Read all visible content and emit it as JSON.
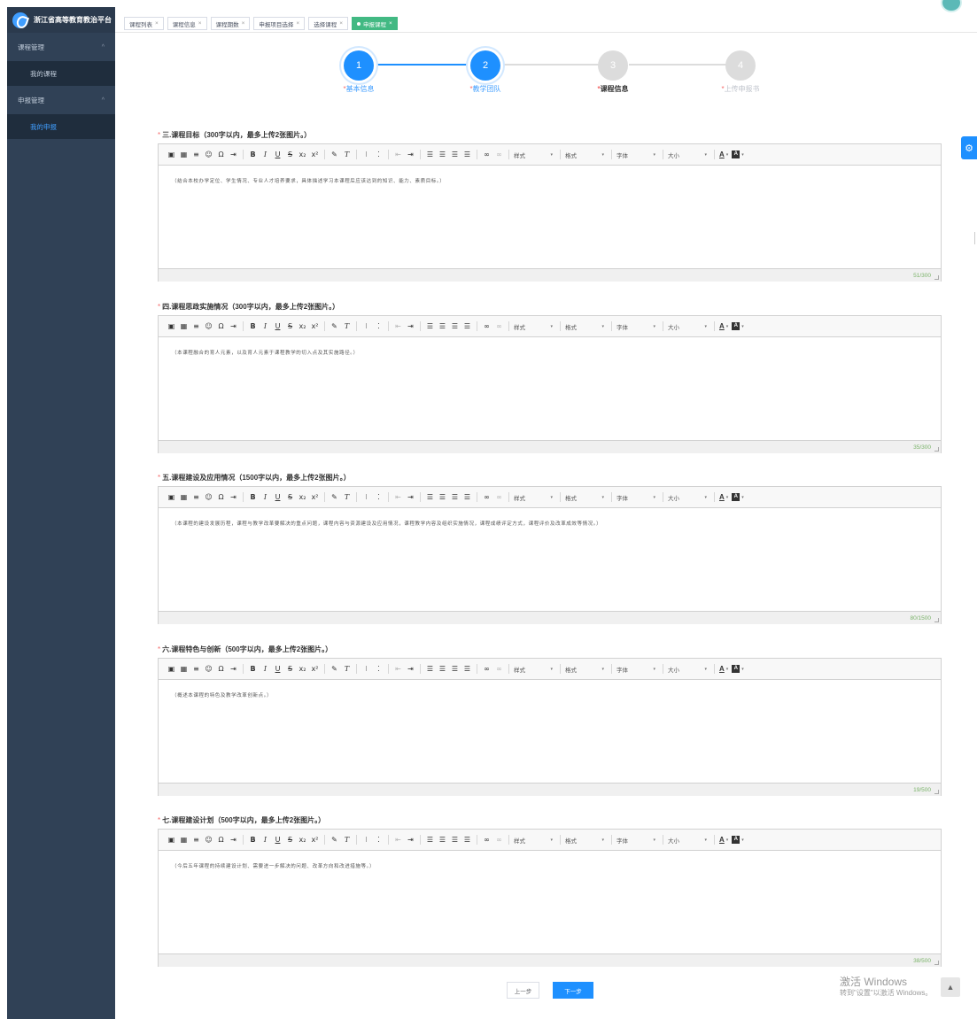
{
  "app": {
    "title": "浙江省高等教育教治平台"
  },
  "sidebar": {
    "groups": [
      {
        "label": "课程管理",
        "items": [
          "我的课程"
        ]
      },
      {
        "label": "申报管理",
        "items": [
          "我的申报"
        ]
      }
    ],
    "chevron": "^",
    "active_item": "我的申报"
  },
  "tabs": [
    {
      "label": "课程列表",
      "active": false
    },
    {
      "label": "课程信息",
      "active": false
    },
    {
      "label": "课程期数",
      "active": false
    },
    {
      "label": "申报项目选择",
      "active": false
    },
    {
      "label": "选择课程",
      "active": false
    },
    {
      "label": "申报课程",
      "active": true
    }
  ],
  "tab_close": "×",
  "steps": [
    {
      "num": "1",
      "label": "基本信息",
      "required": "*",
      "state": "done"
    },
    {
      "num": "2",
      "label": "教学团队",
      "required": "*",
      "state": "done"
    },
    {
      "num": "3",
      "label": "课程信息",
      "required": "*",
      "state": "current"
    },
    {
      "num": "4",
      "label": "上传申报书",
      "required": "*",
      "state": "todo"
    }
  ],
  "toolbar": {
    "combos": [
      "样式",
      "格式",
      "字体",
      "大小"
    ],
    "combo_arrow": "▾"
  },
  "sections": [
    {
      "required": "*",
      "title": "三.课程目标（300字以内，最多上传2张图片。）",
      "placeholder": "（结合本校办学定位、学生情况、专业人才培养要求，具体描述学习本课程后应该达到的知识、能力、素质目标。）",
      "count": "51/300"
    },
    {
      "required": "*",
      "title": "四.课程思政实施情况（300字以内，最多上传2张图片。）",
      "placeholder": "（本课程融合的育人元素，以及育人元素于课程教学的切入点及其实施路径。）",
      "count": "35/300"
    },
    {
      "required": "*",
      "title": "五.课程建设及应用情况（1500字以内，最多上传2张图片。）",
      "placeholder": "（本课程的建设发展历程，课程与教学改革要解决的重点问题，课程内容与资源建设及应用情况，课程教学内容及组织实施情况，课程成绩评定方式，课程评价及改革成效等情况。）",
      "count": "80/1500"
    },
    {
      "required": "*",
      "title": "六.课程特色与创新（500字以内，最多上传2张图片。）",
      "placeholder": "（概述本课程的特色及教学改革创新点。）",
      "count": "19/500"
    },
    {
      "required": "*",
      "title": "七.课程建设计划（500字以内，最多上传2张图片。）",
      "placeholder": "（今后五年课程的持续建设计划、需要进一步解决的问题、改革方向和改进措施等。）",
      "count": "38/500"
    }
  ],
  "buttons": {
    "prev": "上一步",
    "next": "下一步"
  },
  "watermark": {
    "line1": "激活 Windows",
    "line2": "转到\"设置\"以激活 Windows。"
  },
  "icons": {
    "gear": "⚙",
    "scroll_top": "▲"
  },
  "colors": {
    "sidebar_bg": "#304156",
    "primary": "#1e90ff",
    "active_tab": "#42b983",
    "required": "#f56c6c",
    "count": "#7bb36a"
  }
}
